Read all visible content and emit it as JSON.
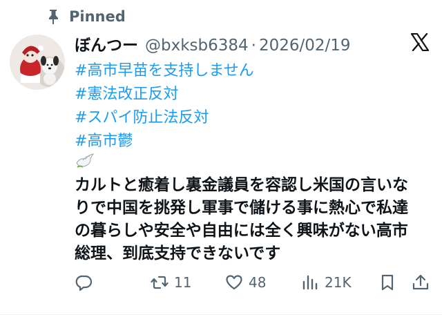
{
  "pinned": {
    "label": "Pinned",
    "icon": "pin-icon"
  },
  "author": {
    "display_name": "ぼんつー",
    "handle": "@bxksb6384",
    "separator": "·",
    "date": "2026/02/19"
  },
  "hashtags": [
    "#高市早苗を支持しません",
    "#憲法改正反対",
    "#スパイ防止法反対",
    "#高市鬱"
  ],
  "body": {
    "emoji": "dove-icon",
    "lines": [
      "カルトと癒着し裏金議員を容認し米国の言いな",
      "りで中国を挑発し軍事で儲ける事に熱心で私達",
      "の暮らしや安全や自由には全く興味がない高市",
      "総理、到底支持できないです"
    ]
  },
  "actions": {
    "reply": {
      "icon": "reply-icon",
      "count": ""
    },
    "repost": {
      "icon": "repost-icon",
      "count": "11"
    },
    "like": {
      "icon": "heart-icon",
      "count": "48"
    },
    "views": {
      "icon": "views-icon",
      "count": "21K"
    },
    "bookmark": {
      "icon": "bookmark-icon"
    },
    "share": {
      "icon": "share-icon"
    }
  },
  "colors": {
    "accent": "#1d9bf0",
    "text": "#0f1419",
    "secondary": "#536471"
  }
}
